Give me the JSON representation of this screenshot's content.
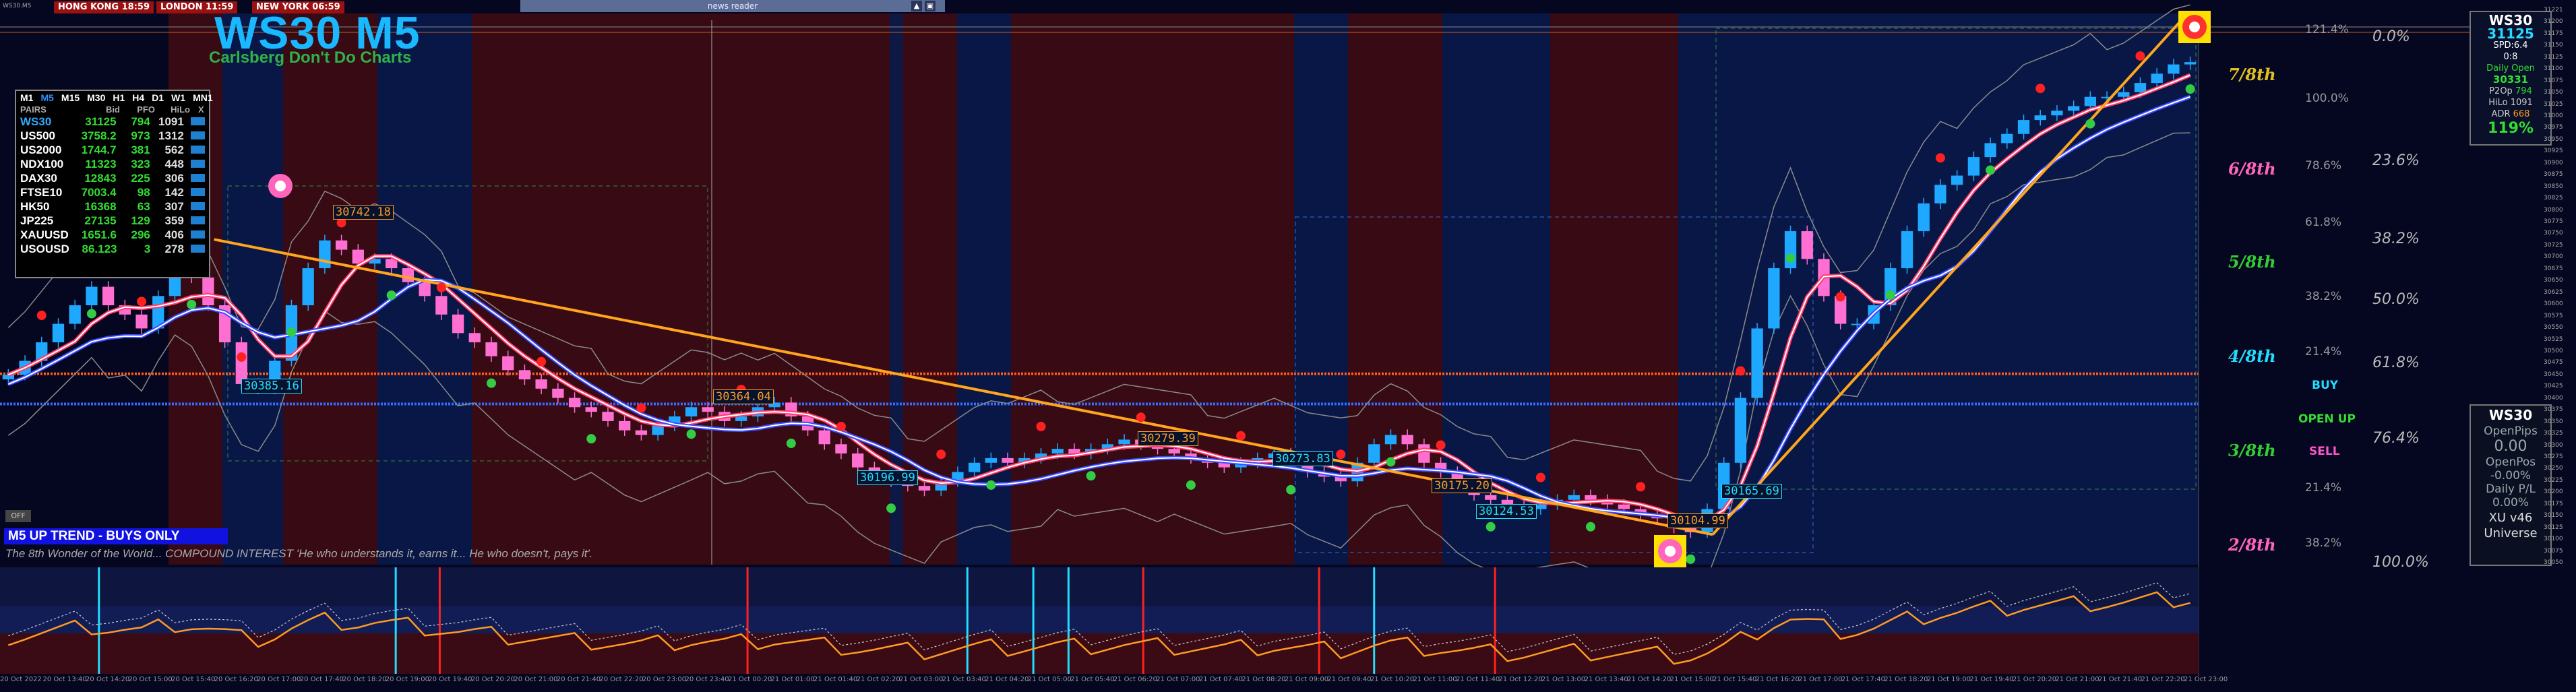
{
  "header": {
    "corner": "WS30.M5",
    "sessions": [
      "HONG KONG 18:59",
      "LONDON 11:59",
      "NEW YORK 06:59"
    ],
    "news": "news reader",
    "title": "WS30 M5",
    "subtitle": "Carlsberg Don't Do Charts"
  },
  "pairs_panel": {
    "timeframes": [
      "M1",
      "M5",
      "M15",
      "M30",
      "H1",
      "H4",
      "D1",
      "W1",
      "MN1"
    ],
    "selected_timeframe": "M5",
    "headers": [
      "PAIRS",
      "Bid",
      "PFO",
      "HiLo",
      "X"
    ],
    "rows": [
      {
        "pair": "WS30",
        "bid": "31125",
        "pfo": "794",
        "hilo": "1091"
      },
      {
        "pair": "US500",
        "bid": "3758.2",
        "pfo": "973",
        "hilo": "1312"
      },
      {
        "pair": "US2000",
        "bid": "1744.7",
        "pfo": "381",
        "hilo": "562"
      },
      {
        "pair": "NDX100",
        "bid": "11323",
        "pfo": "323",
        "hilo": "448"
      },
      {
        "pair": "DAX30",
        "bid": "12843",
        "pfo": "225",
        "hilo": "306"
      },
      {
        "pair": "FTSE10",
        "bid": "7003.4",
        "pfo": "98",
        "hilo": "142"
      },
      {
        "pair": "HK50",
        "bid": "16368",
        "pfo": "63",
        "hilo": "307"
      },
      {
        "pair": "JP225",
        "bid": "27135",
        "pfo": "129",
        "hilo": "359"
      },
      {
        "pair": "XAUUSD",
        "bid": "1651.6",
        "pfo": "296",
        "hilo": "406"
      },
      {
        "pair": "USOUSD",
        "bid": "86.123",
        "pfo": "3",
        "hilo": "278"
      }
    ]
  },
  "bottom_left": {
    "off": "OFF",
    "trend": "M5 UP TREND - BUYS ONLY",
    "motto": "The 8th Wonder of the World... COMPOUND INTEREST 'He who understands it, earns it... He who doesn't, pays it'."
  },
  "fib_labels": [
    {
      "text": "7/8th",
      "color": "#e0c020"
    },
    {
      "text": "6/8th",
      "color": "#ff66bb"
    },
    {
      "text": "5/8th",
      "color": "#33cc33"
    },
    {
      "text": "4/8th",
      "color": "#22ddff"
    },
    {
      "text": "3/8th",
      "color": "#33cc33"
    },
    {
      "text": "2/8th",
      "color": "#ff66bb"
    }
  ],
  "percent_labels": [
    "0.0%",
    "23.6%",
    "38.2%",
    "50.0%",
    "61.8%",
    "76.4%",
    "100.0%"
  ],
  "small_percent_labels": [
    "121.4%",
    "100.0%",
    "78.6%",
    "61.8%",
    "38.2%",
    "21.4%",
    "21.4%",
    "38.2%"
  ],
  "signals": {
    "buy": "BUY",
    "open": "OPEN UP",
    "sell": "SELL"
  },
  "info_box": {
    "symbol": "WS30",
    "price": "31125",
    "spd": "SPD:6.4",
    "ratio": "0:8",
    "daily_open_label": "Daily Open",
    "daily_open": "30331",
    "p2op": "P2Op",
    "p2op_val": "794",
    "hilo": "HiLo",
    "hilo_val": "1091",
    "adr": "ADR",
    "adr_val": "668",
    "adr_pct": "119%"
  },
  "pips_box": {
    "symbol": "WS30",
    "open_pips_label": "OpenPips",
    "open_pips": "0.00",
    "open_pos_label": "OpenPos",
    "open_pos": "-0.00%",
    "daily_pl_label": "Daily P/L",
    "daily_pl": "0.00%",
    "version": "XU v46",
    "universe": "Universe"
  },
  "price_labels": [
    {
      "text": "30742.18",
      "color": "#ff9a22"
    },
    {
      "text": "30385.16",
      "color": "#22ddff"
    },
    {
      "text": "30364.04",
      "color": "#ff9a22"
    },
    {
      "text": "30196.99",
      "color": "#22ddff"
    },
    {
      "text": "30279.39",
      "color": "#ff9a22"
    },
    {
      "text": "30273.83",
      "color": "#22ddff"
    },
    {
      "text": "30175.20",
      "color": "#ff9a22"
    },
    {
      "text": "30124.53",
      "color": "#22ddff"
    },
    {
      "text": "30104.99",
      "color": "#ff9a22"
    },
    {
      "text": "30165.69",
      "color": "#22ddff"
    }
  ],
  "colors": {
    "bull_candle": "#1fa8ff",
    "bear_candle": "#ff6fd2",
    "trendline": "#ffa51e",
    "bg_red_zone": "#3a0b14",
    "bg_blue_zone": "#0a1a4a"
  },
  "chart_data": {
    "type": "line",
    "symbol": "WS30",
    "timeframe": "M5",
    "x_tick_labels": [
      "20 Oct 2022",
      "20 Oct 13:40",
      "20 Oct 14:20",
      "20 Oct 15:00",
      "20 Oct 15:40",
      "20 Oct 16:20",
      "20 Oct 17:00",
      "20 Oct 17:40",
      "20 Oct 18:20",
      "20 Oct 19:00",
      "20 Oct 19:40",
      "20 Oct 20:20",
      "20 Oct 21:00",
      "20 Oct 21:40",
      "20 Oct 22:20",
      "20 Oct 23:00",
      "20 Oct 23:40",
      "21 Oct 00:20",
      "21 Oct 01:00",
      "21 Oct 01:40",
      "21 Oct 02:20",
      "21 Oct 03:00",
      "21 Oct 03:40",
      "21 Oct 04:20",
      "21 Oct 05:00",
      "21 Oct 05:40",
      "21 Oct 06:20",
      "21 Oct 07:00",
      "21 Oct 07:40",
      "21 Oct 08:20",
      "21 Oct 09:00",
      "21 Oct 09:40",
      "21 Oct 10:20",
      "21 Oct 11:00",
      "21 Oct 11:40",
      "21 Oct 12:20",
      "21 Oct 13:00",
      "21 Oct 13:40",
      "21 Oct 14:20",
      "21 Oct 15:00",
      "21 Oct 15:40",
      "21 Oct 16:20",
      "21 Oct 17:00",
      "21 Oct 17:40",
      "21 Oct 18:20",
      "21 Oct 19:00",
      "21 Oct 19:40",
      "21 Oct 20:20",
      "21 Oct 21:00",
      "21 Oct 21:40",
      "21 Oct 22:20",
      "21 Oct 23:00"
    ],
    "y_tick_labels": [
      "31221",
      "31200",
      "31175",
      "31150",
      "31125",
      "31100",
      "31075",
      "31050",
      "31025",
      "31000",
      "30975",
      "30950",
      "30925",
      "30900",
      "30875",
      "30850",
      "30825",
      "30800",
      "30775",
      "30750",
      "30725",
      "30700",
      "30675",
      "30650",
      "30625",
      "30600",
      "30575",
      "30550",
      "30525",
      "30500",
      "30475",
      "30450",
      "30425",
      "30400",
      "30375",
      "30350",
      "30325",
      "30300",
      "30275",
      "30250",
      "30225",
      "30200",
      "30175",
      "30150",
      "30125",
      "30100",
      "30075",
      "30050"
    ],
    "ylim": [
      30040,
      31230
    ],
    "close": [
      30450,
      30480,
      30520,
      30560,
      30600,
      30640,
      30600,
      30580,
      30550,
      30620,
      30680,
      30660,
      30600,
      30520,
      30430,
      30420,
      30480,
      30600,
      30680,
      30740,
      30720,
      30690,
      30700,
      30680,
      30650,
      30620,
      30580,
      30540,
      30520,
      30490,
      30460,
      30440,
      30420,
      30400,
      30380,
      30370,
      30350,
      30330,
      30320,
      30340,
      30360,
      30380,
      30370,
      30350,
      30360,
      30380,
      30390,
      30360,
      30330,
      30300,
      30280,
      30250,
      30230,
      30220,
      30210,
      30200,
      30220,
      30240,
      30260,
      30270,
      30260,
      30270,
      30280,
      30290,
      30280,
      30290,
      30300,
      30310,
      30300,
      30290,
      30280,
      30270,
      30260,
      30250,
      30260,
      30270,
      30280,
      30260,
      30240,
      30230,
      30220,
      30260,
      30300,
      30320,
      30300,
      30260,
      30240,
      30210,
      30190,
      30180,
      30170,
      30160,
      30170,
      30180,
      30190,
      30180,
      30170,
      30160,
      30150,
      30140,
      30120,
      30110,
      30160,
      30260,
      30400,
      30550,
      30680,
      30760,
      30700,
      30620,
      30560,
      30560,
      30600,
      30680,
      30760,
      30820,
      30860,
      30880,
      30920,
      30950,
      30970,
      31000,
      31010,
      31020,
      31030,
      31050,
      31050,
      31060,
      31080,
      31100,
      31120,
      31125
    ],
    "trendlines": [
      {
        "from": {
          "x": "20 Oct 16:20",
          "y": 30742.18
        },
        "to": {
          "x": "21 Oct 15:40",
          "y": 30104.99
        }
      },
      {
        "from": {
          "x": "21 Oct 15:40",
          "y": 30104.99
        },
        "to": {
          "x": "21 Oct 23:00",
          "y": 31221
        }
      }
    ],
    "horizontal_levels": [
      30452,
      30387
    ]
  }
}
